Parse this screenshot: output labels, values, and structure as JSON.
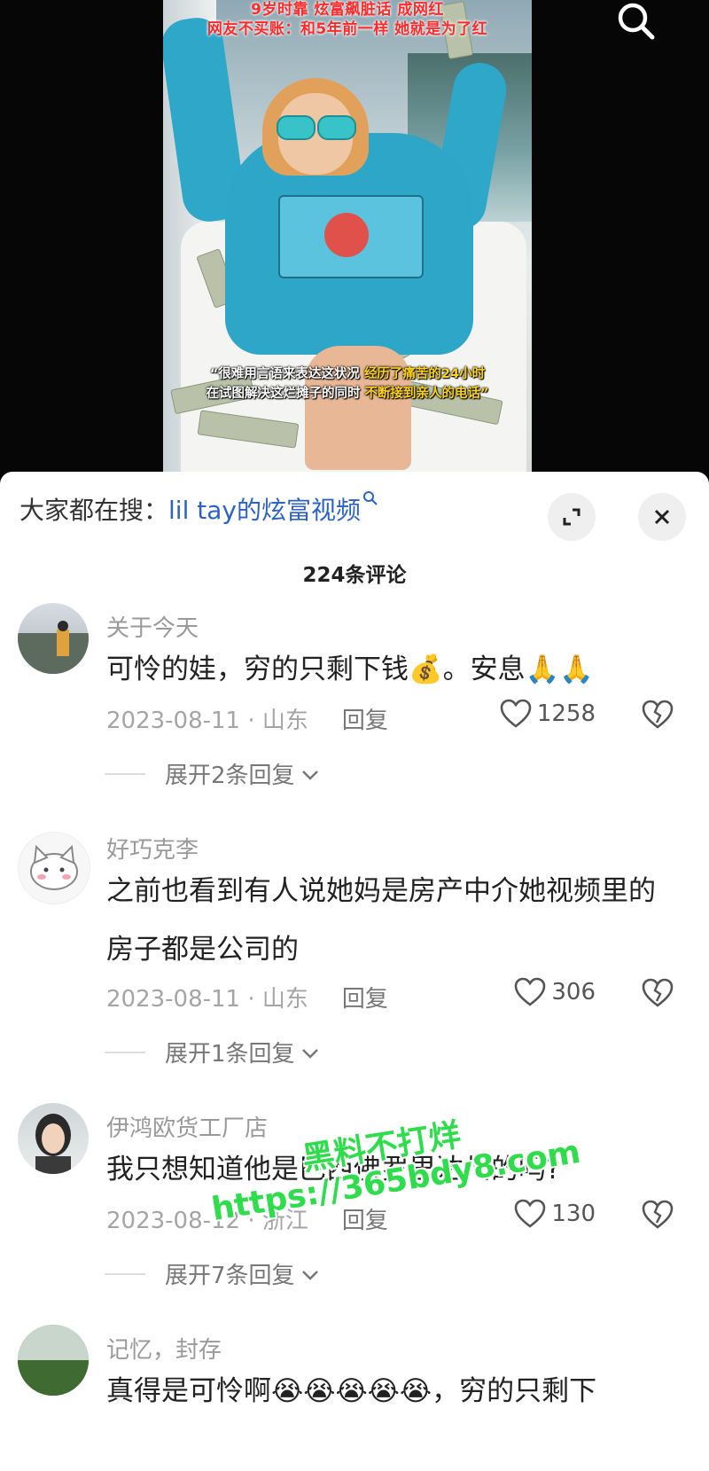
{
  "video": {
    "headline_line1": "9岁时靠  炫富飙脏话  成网红",
    "headline_line2": "网友不买账：和5年前一样 她就是为了红",
    "caption_line1_plain": "“很难用言语来表达这状况 ",
    "caption_line1_highlight": "经历了痛苦的24小时",
    "caption_line2_plain": "在试图解决这烂摊子的同时 ",
    "caption_line2_highlight": "不断接到亲人的电话”",
    "search_icon": "search-icon"
  },
  "sheet": {
    "search_prefix": "大家都在搜：",
    "search_query": "lil tay的炫富视频",
    "expand_icon": "expand-icon",
    "close_icon": "close-icon",
    "comment_count_title": "224条评论"
  },
  "comments": [
    {
      "user": "关于今天",
      "text": "可怜的娃，穷的只剩下钱💰。安息🙏🙏",
      "date": "2023-08-11 · 山东",
      "reply_label": "回复",
      "likes": "1258",
      "expand": "展开2条回复"
    },
    {
      "user": "好巧克李",
      "text": "之前也看到有人说她妈是房产中介她视频里的房子都是公司的",
      "date": "2023-08-11 · 山东",
      "reply_label": "回复",
      "likes": "306",
      "expand": "展开1条回复"
    },
    {
      "user": "伊鸿欧货工厂店",
      "text": "我只想知道他是巴西佛罗里达州的吗?",
      "date": "2023-08-12 · 浙江",
      "reply_label": "回复",
      "likes": "130",
      "expand": "展开7条回复"
    },
    {
      "user": "记忆，封存",
      "text": "真得是可怜啊😭😭😭😭😭，穷的只剩下"
    }
  ],
  "watermark": {
    "line1": "黑料不打烊",
    "line2": "https://365bdy8.com"
  },
  "colors": {
    "link_blue": "#2c62c4",
    "watermark_green": "#2fdc4c",
    "headline_red": "#ff2b2b",
    "caption_yellow": "#ffd31a"
  }
}
